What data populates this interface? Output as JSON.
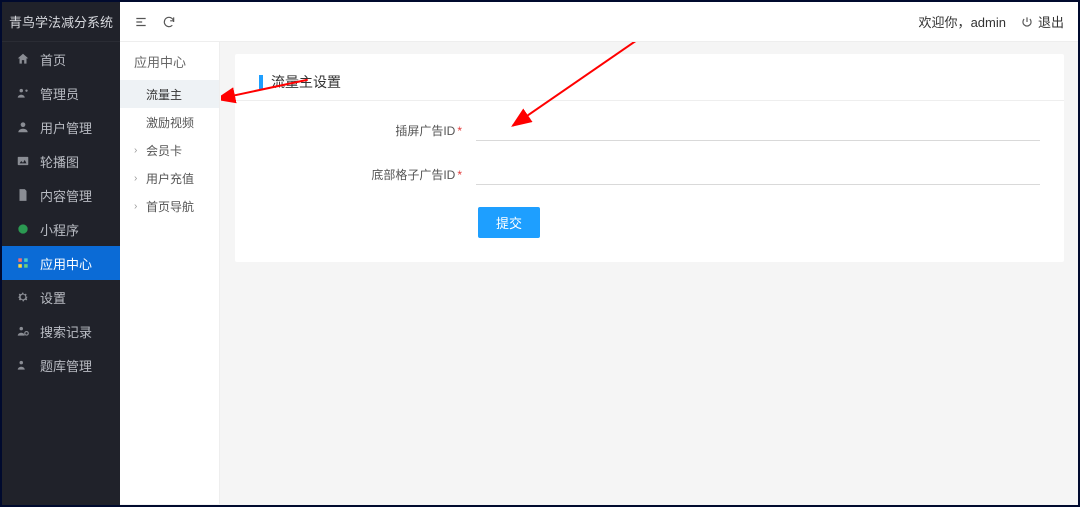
{
  "brand": "青鸟学法减分系统",
  "header": {
    "welcome_prefix": "欢迎你，",
    "user": "admin",
    "logout": "退出"
  },
  "sidebar": {
    "items": [
      {
        "label": "首页",
        "icon": "home"
      },
      {
        "label": "管理员",
        "icon": "user-cog"
      },
      {
        "label": "用户管理",
        "icon": "user"
      },
      {
        "label": "轮播图",
        "icon": "image"
      },
      {
        "label": "内容管理",
        "icon": "file"
      },
      {
        "label": "小程序",
        "icon": "grid"
      },
      {
        "label": "应用中心",
        "icon": "layers"
      },
      {
        "label": "设置",
        "icon": "gear"
      },
      {
        "label": "搜索记录",
        "icon": "search-user"
      },
      {
        "label": "题库管理",
        "icon": "user-book"
      }
    ],
    "active_index": 6
  },
  "subside": {
    "title": "应用中心",
    "items": [
      {
        "label": "流量主",
        "expandable": false,
        "active": true
      },
      {
        "label": "激励视频",
        "expandable": false,
        "active": false
      },
      {
        "label": "会员卡",
        "expandable": true,
        "active": false
      },
      {
        "label": "用户充值",
        "expandable": true,
        "active": false
      },
      {
        "label": "首页导航",
        "expandable": true,
        "active": false
      }
    ]
  },
  "form": {
    "title": "流量主设置",
    "fields": [
      {
        "label": "插屏广告ID",
        "required": true,
        "value": ""
      },
      {
        "label": "底部格子广告ID",
        "required": true,
        "value": ""
      }
    ],
    "submit": "提交"
  }
}
